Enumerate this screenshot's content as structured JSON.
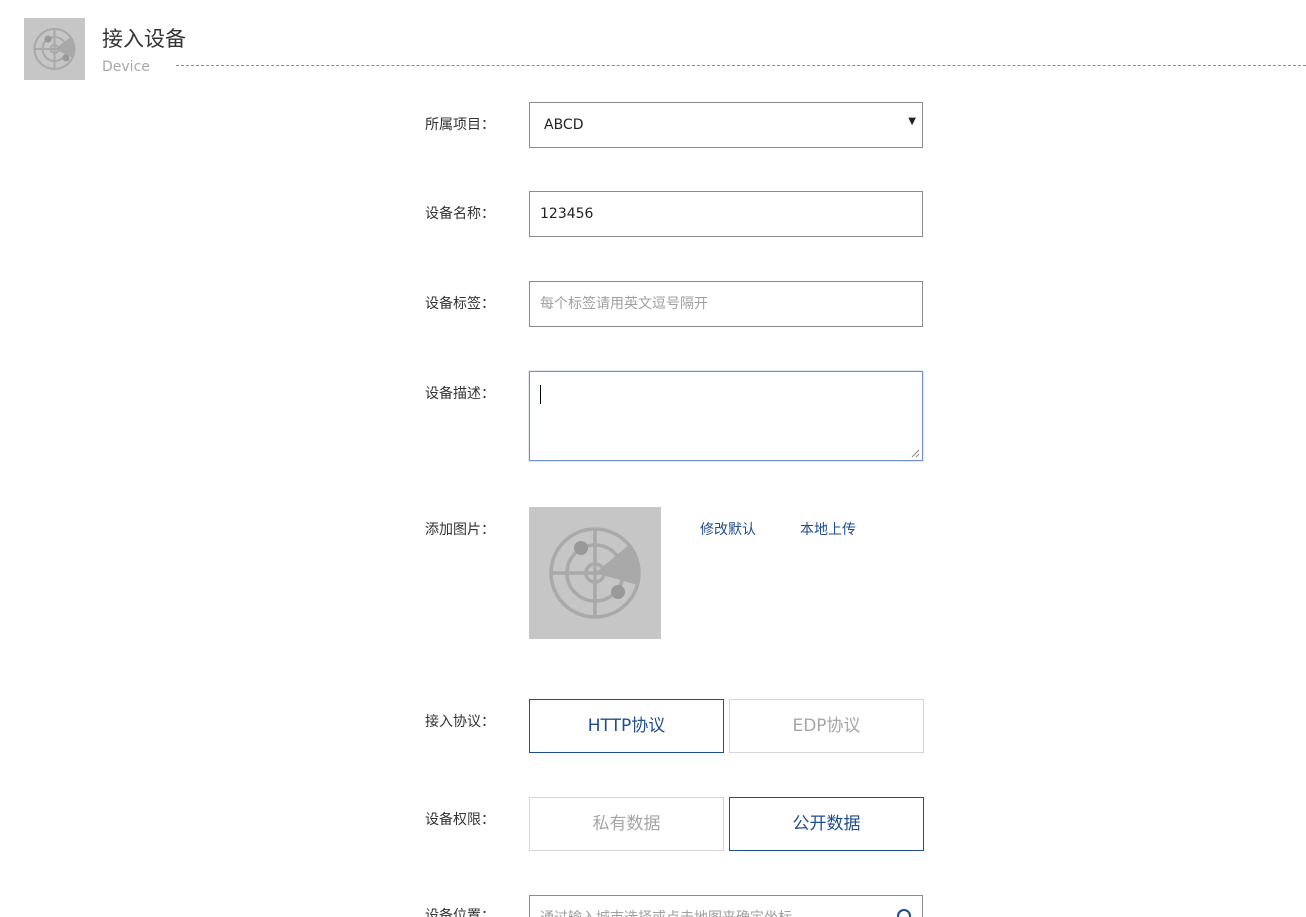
{
  "header": {
    "title": "接入设备",
    "subtitle": "Device",
    "icon": "radar-icon"
  },
  "form": {
    "project": {
      "label": "所属项目：",
      "value": "ABCD"
    },
    "device_name": {
      "label": "设备名称：",
      "value": "123456"
    },
    "device_tags": {
      "label": "设备标签：",
      "placeholder": "每个标签请用英文逗号隔开"
    },
    "device_description": {
      "label": "设备描述：",
      "value": ""
    },
    "image": {
      "label": "添加图片：",
      "modify_default": "修改默认",
      "local_upload": "本地上传"
    },
    "protocol": {
      "label": "接入协议：",
      "options": [
        "HTTP协议",
        "EDP协议"
      ],
      "selected": "HTTP协议"
    },
    "permission": {
      "label": "设备权限：",
      "options": [
        "私有数据",
        "公开数据"
      ],
      "selected": "公开数据"
    },
    "location": {
      "label": "设备位置：",
      "placeholder": "通过输入城市选择或点击地图来确定坐标"
    }
  },
  "colors": {
    "accent": "#1f4e8c",
    "border": "#8c8c8c",
    "focus_border": "#6f8fcc",
    "icon_bg": "#c6c6c6"
  }
}
